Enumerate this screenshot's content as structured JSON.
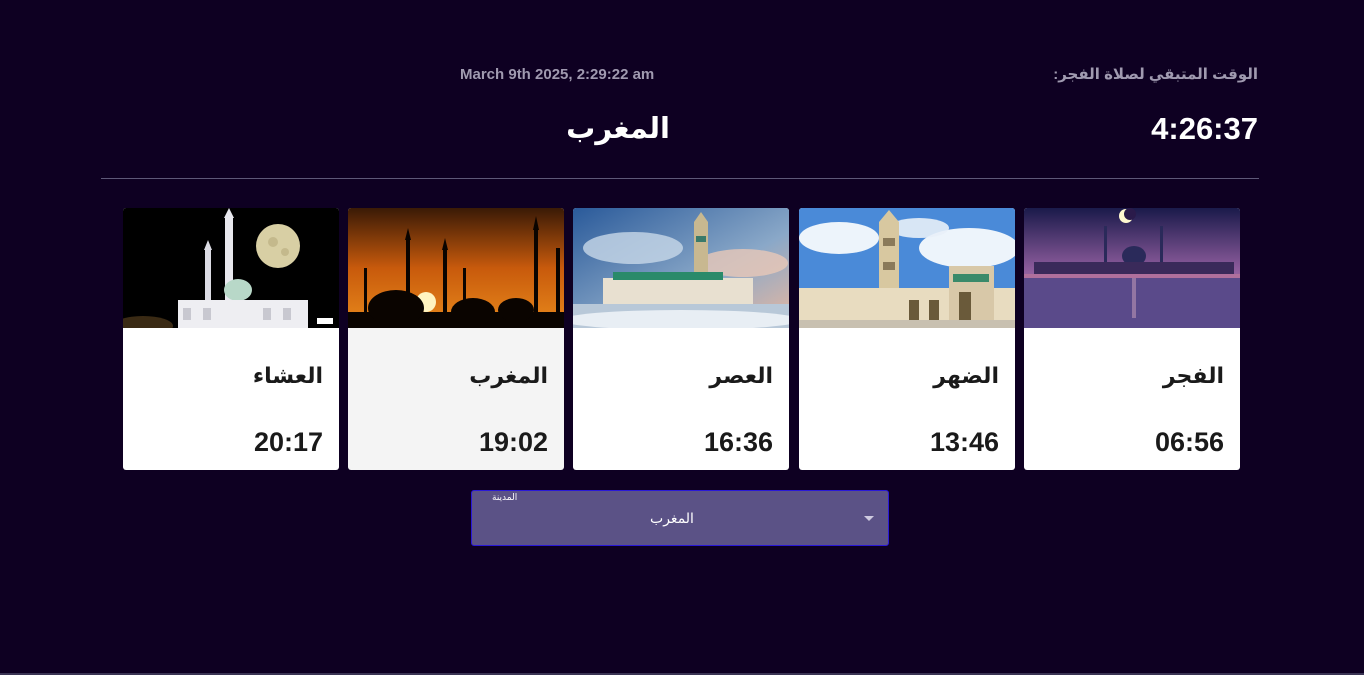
{
  "header": {
    "date": "March 9th 2025, 2:29:22 am",
    "remaining_label": "الوقت المتبقي لصلاة الفجر:",
    "city": "المغرب",
    "countdown": "4:26:37"
  },
  "prayers": [
    {
      "name": "العشاء",
      "time": "20:17",
      "image": "mosque-full-moon-night-image"
    },
    {
      "name": "المغرب",
      "time": "19:02",
      "image": "minarets-sunset-image",
      "highlighted": true
    },
    {
      "name": "العصر",
      "time": "16:36",
      "image": "hassan-ii-mosque-image"
    },
    {
      "name": "الضهر",
      "time": "13:46",
      "image": "mosque-minaret-day-image"
    },
    {
      "name": "الفجر",
      "time": "06:56",
      "image": "mosque-crescent-dawn-image"
    }
  ],
  "city_select": {
    "label": "المدينة",
    "value": "المغرب"
  },
  "colors": {
    "background": "#0e0022",
    "select_background": "#5b5286",
    "select_border": "#2a18d8"
  }
}
